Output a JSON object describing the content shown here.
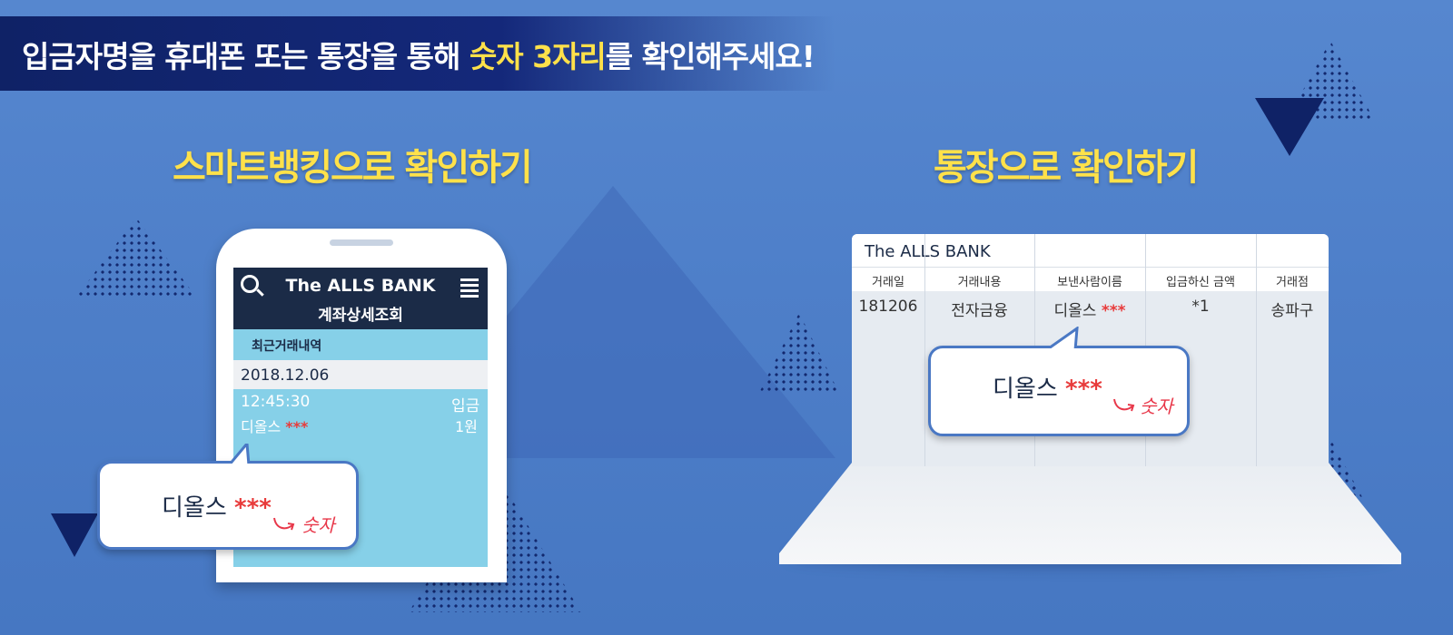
{
  "banner": {
    "prefix": "입금자명을 휴대폰 또는 통장을 통해 ",
    "highlight": "숫자 3자리",
    "suffix": "를 확인해주세요!"
  },
  "sections": {
    "smart_title": "스마트뱅킹으로 확인하기",
    "book_title": "통장으로 확인하기"
  },
  "phone": {
    "app_title": "The ALLS BANK",
    "app_subtitle": "계좌상세조회",
    "recent_label": "최근거래내역",
    "date": "2018.12.06",
    "time": "12:45:30",
    "type": "입금",
    "name": "디올스",
    "stars": "***",
    "amount": "1원"
  },
  "passbook": {
    "bank_name": "The ALLS BANK",
    "columns": [
      "거래일",
      "거래내용",
      "보낸사람이름",
      "입금하신 금액",
      "거래점"
    ],
    "row": [
      "181206",
      "전자금융",
      "디올스",
      "*1",
      "송파구"
    ],
    "row_stars": "***"
  },
  "callouts": {
    "name": "디올스",
    "stars": "***",
    "note": "숫자"
  },
  "colors": {
    "background": "#4e7fc9",
    "banner": "#0f2266",
    "highlight": "#ffe14a",
    "phone_header": "#1b2b47",
    "phone_screen": "#86d0e8",
    "stars": "#e83b3b"
  }
}
